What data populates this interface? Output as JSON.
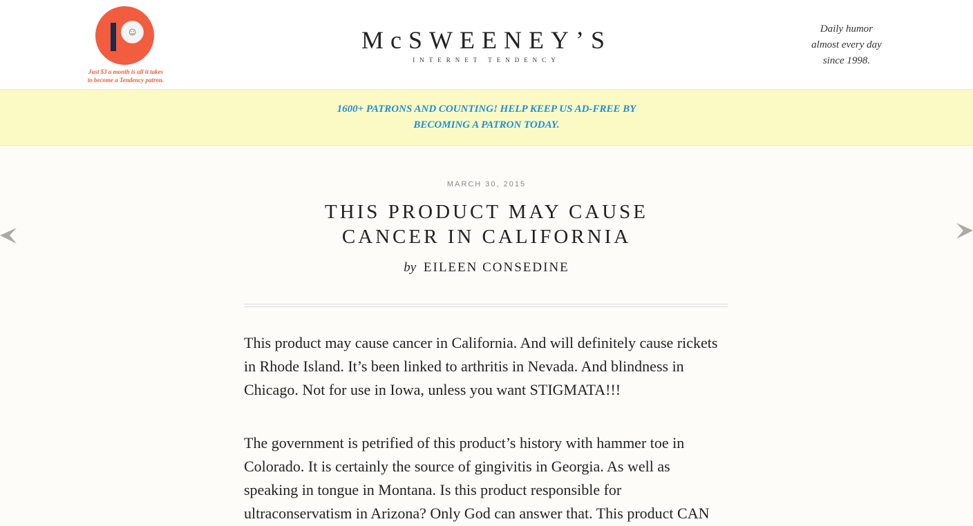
{
  "patreon": {
    "tagline_line1": "Just $3 a month is all it takes",
    "tagline_line2": "to become a Tendency patron.",
    "color": "#f25c3f"
  },
  "site": {
    "title": "McSWEENEY’S",
    "subtitle": "INTERNET TENDENCY",
    "tagline_line1": "Daily humor",
    "tagline_line2": "almost every day",
    "tagline_line3": "since 1998."
  },
  "banner": {
    "line1": "1600+ PATRONS AND COUNTING! HELP KEEP US AD-FREE BY",
    "line2": "BECOMING A PATRON TODAY.",
    "background": "#fcfac4",
    "text_color": "#1b8fd6"
  },
  "article": {
    "date": "MARCH 30, 2015",
    "title_line1": "THIS PRODUCT MAY CAUSE",
    "title_line2": "CANCER IN CALIFORNIA",
    "by": "by",
    "author": "EILEEN CONSEDINE",
    "paragraphs": [
      {
        "lines": [
          "This product may cause cancer in California. And will definitely cause rickets",
          "in Rhode Island. It’s been linked to arthritis in Nevada. And blindness in",
          "Chicago. Not for use in Iowa, unless you want STIGMATA!!!"
        ]
      },
      {
        "lines": [
          "The government is petrified of this product’s history with hammer toe in",
          "Colorado. It is certainly the source of gingivitis in Georgia. As well as",
          "speaking in tongue in Montana. Is this product responsible for",
          "ultraconservatism in Arizona? Only God can answer that. This product CAN"
        ]
      }
    ]
  },
  "nav": {
    "prev_icon": "arrow-left-icon",
    "next_icon": "arrow-right-icon",
    "arrow_color": "#aaaaaa"
  }
}
